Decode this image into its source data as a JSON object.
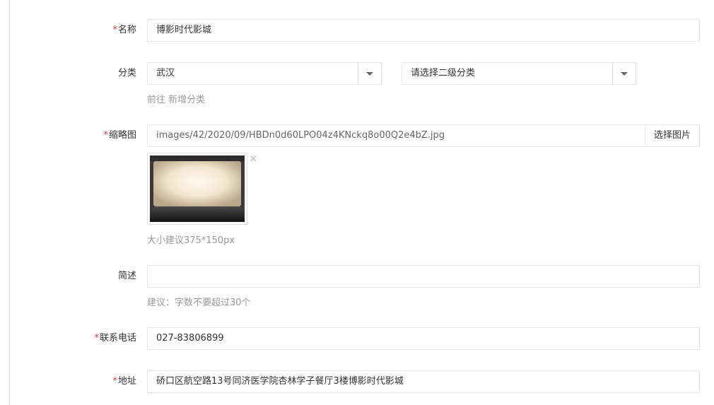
{
  "form": {
    "name": {
      "required_mark": "*",
      "label": "名称",
      "value": "博影时代影城"
    },
    "category": {
      "label": "分类",
      "primary_selected": "武汉",
      "secondary_placeholder": "请选择二级分类",
      "goto_text": "前往 新增分类"
    },
    "thumbnail": {
      "required_mark": "*",
      "label": "缩略图",
      "path": "images/42/2020/09/HBDn0d60LPO04z4KNckq8o00Q2e4bZ.jpg",
      "choose_button": "选择图片",
      "remove_icon": "×",
      "size_hint": "大小建议375*150px"
    },
    "description": {
      "label": "简述",
      "value": "",
      "hint": "建议：字数不要超过30个"
    },
    "phone": {
      "required_mark": "*",
      "label": "联系电话",
      "value": "027-83806899"
    },
    "address": {
      "required_mark": "*",
      "label": "地址",
      "value": "硚口区航空路13号同济医学院杏林学子餐厅3楼博影时代影城"
    }
  },
  "colors": {
    "required": "#e4393c",
    "hint": "#999999",
    "border": "#e6e6e6"
  }
}
